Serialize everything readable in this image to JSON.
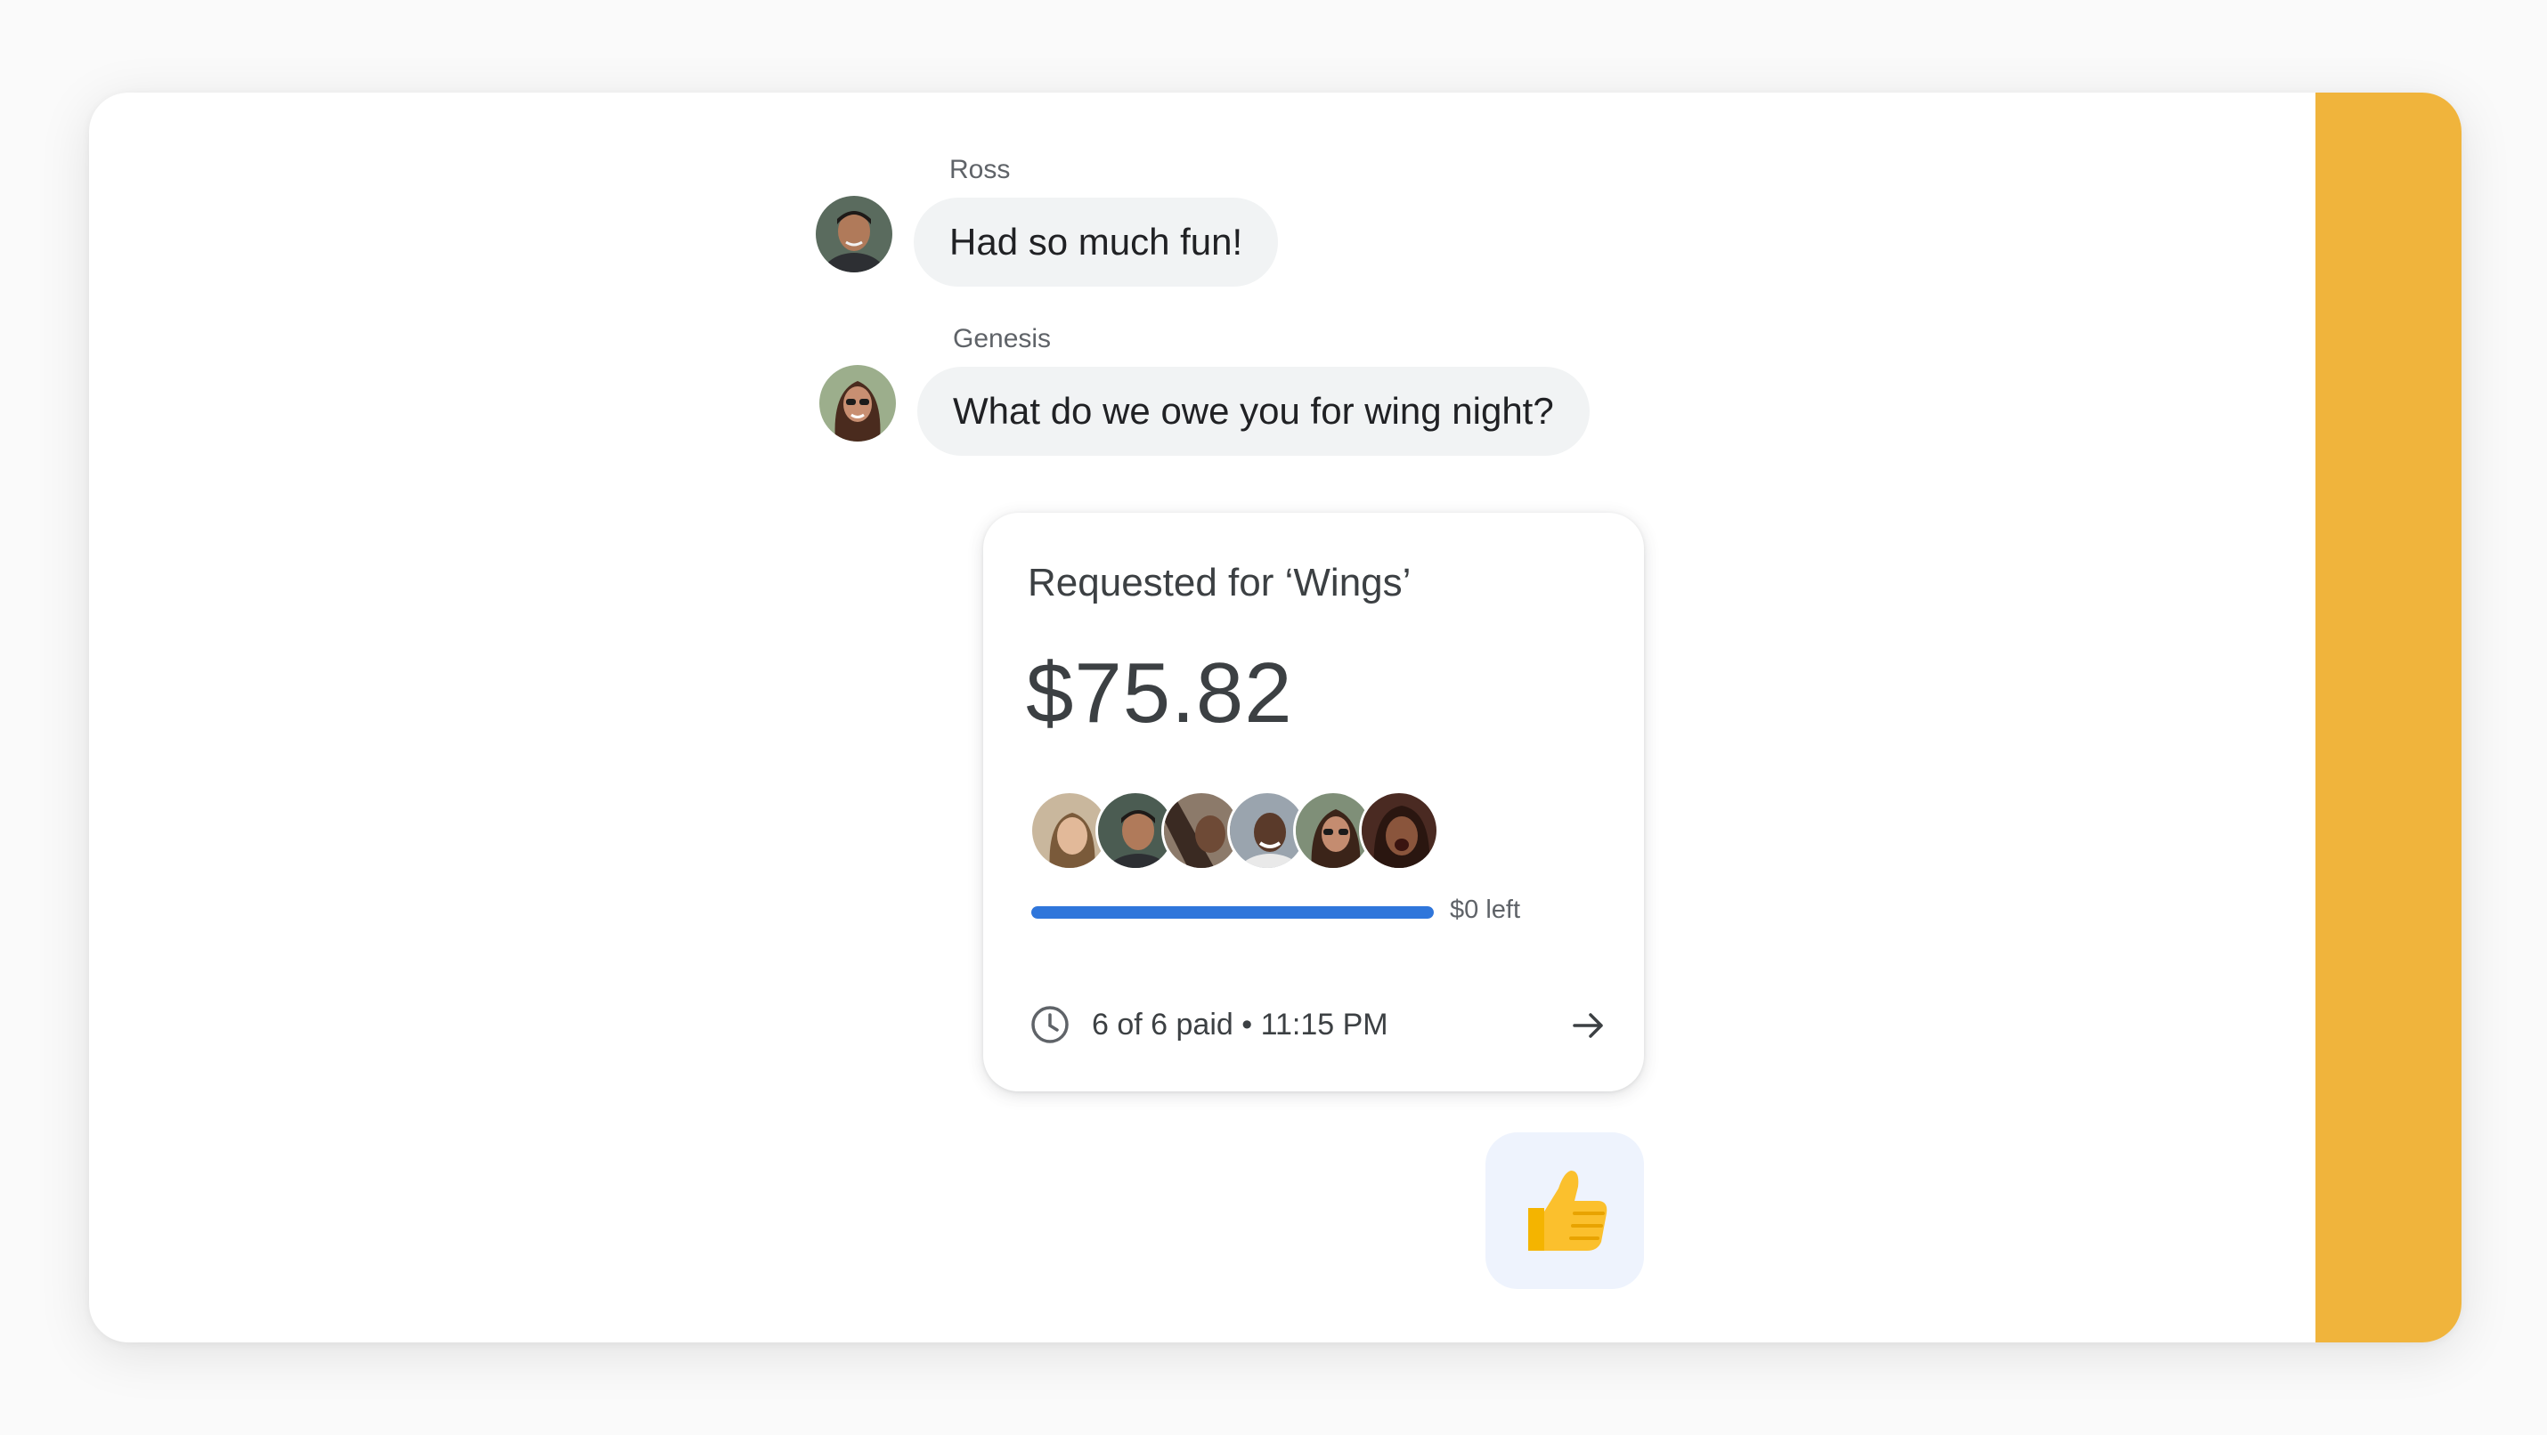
{
  "messages": [
    {
      "sender": "Ross",
      "text": "Had so much fun!"
    },
    {
      "sender": "Genesis",
      "text": "What do we owe you for wing night?"
    }
  ],
  "request_card": {
    "title": "Requested for ‘Wings’",
    "amount": "$75.82",
    "payer_count": 6,
    "progress_fraction": 1.0,
    "remaining_label": "$0 left",
    "status": "6 of 6 paid • 11:15 PM",
    "status_icon": "clock-icon",
    "action_icon": "arrow-right-icon"
  },
  "reaction": {
    "emoji": "👍",
    "icon": "thumbs-up-icon"
  },
  "colors": {
    "accent": "#f0b43c",
    "progress": "#2f76db",
    "bubble": "#f1f3f4",
    "reaction_bg": "#eef3fd"
  }
}
